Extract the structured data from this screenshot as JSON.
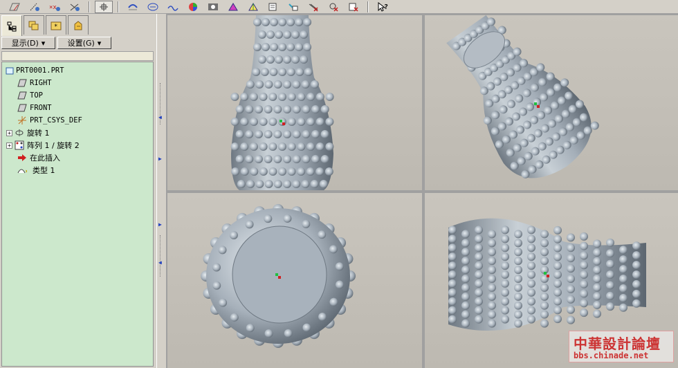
{
  "toolbar": {
    "buttons": [
      "datum-plane-display",
      "datum-axis-display",
      "datum-point-display",
      "csys-display",
      "spin-center",
      "repaint",
      "orient",
      "view-manager",
      "shade",
      "hidden",
      "wireframe",
      "no-hidden",
      "saved-views",
      "layers",
      "model-tree-toggle",
      "display-style",
      "context-help"
    ]
  },
  "panel": {
    "tabs": [
      "model-tree",
      "layers",
      "folder-browser",
      "favorites"
    ],
    "show_button": "显示(D)",
    "settings_button": "设置(G)"
  },
  "tree": {
    "root": "PRT0001.PRT",
    "items": [
      {
        "label": "RIGHT",
        "icon": "datum-plane-icon"
      },
      {
        "label": "TOP",
        "icon": "datum-plane-icon"
      },
      {
        "label": "FRONT",
        "icon": "datum-plane-icon"
      },
      {
        "label": "PRT_CSYS_DEF",
        "icon": "csys-icon"
      },
      {
        "label": "旋转 1",
        "icon": "revolve-icon"
      },
      {
        "label": "阵列 1 / 旋转 2",
        "icon": "pattern-icon"
      },
      {
        "label": "在此插入",
        "icon": "insert-here-icon"
      },
      {
        "label": "类型 1",
        "icon": "pattern-type-icon"
      }
    ]
  },
  "colors": {
    "model": "#a8b0b8",
    "viewport_bg": "#c4c0b8",
    "tree_bg": "#cce8cc"
  },
  "watermark": {
    "title": "中華設計論壇",
    "url": "bbs.chinade.net"
  }
}
